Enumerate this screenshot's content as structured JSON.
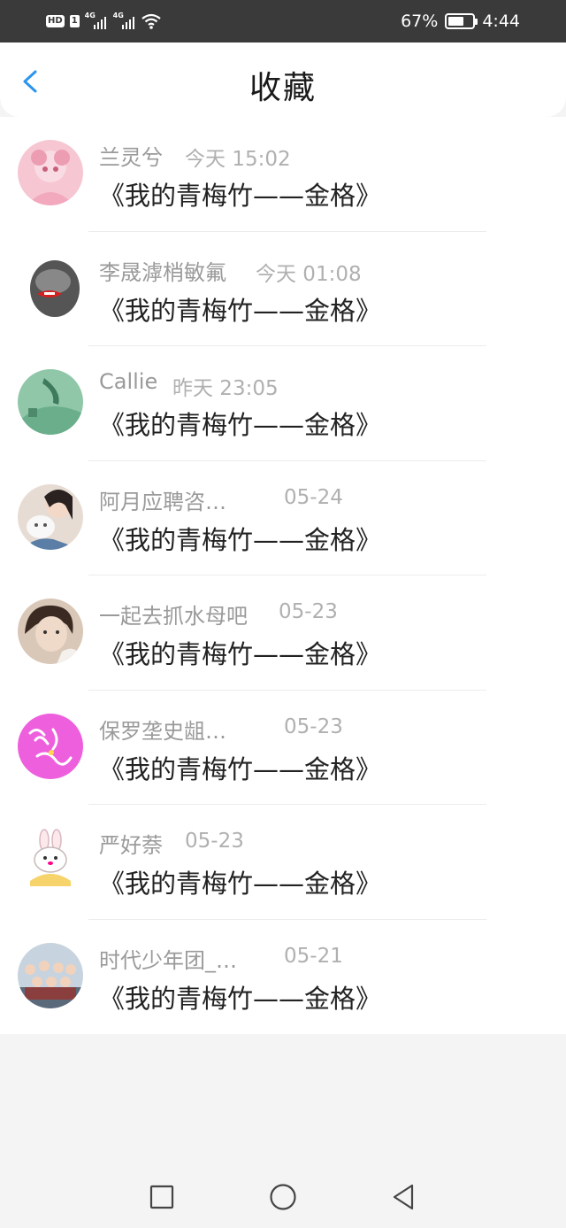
{
  "status_bar": {
    "hd": "HD",
    "sim": "1",
    "network1": "4G",
    "network2": "4G",
    "battery_percent": "67%",
    "battery_level": 0.67,
    "time": "4:44"
  },
  "header": {
    "title": "收藏",
    "back_icon": "chevron-left-icon"
  },
  "colors": {
    "accent": "#2b95ee",
    "status_bar_bg": "#3a3a3a",
    "name_text": "#9a9a9a",
    "time_text": "#b0b0b0",
    "content_text": "#222222"
  },
  "favorites": [
    {
      "name": "兰灵兮",
      "time": "今天 15:02",
      "content": "《我的青梅竹——金格》",
      "avatar": "pink-anime-avatar"
    },
    {
      "name": "李晟滹梢敏氟",
      "time": "今天 01:08",
      "content": "《我的青梅竹——金格》",
      "avatar": "monochrome-face-avatar"
    },
    {
      "name": "Callie",
      "time": "昨天 23:05",
      "content": "《我的青梅竹——金格》",
      "avatar": "green-abstract-avatar"
    },
    {
      "name": "阿月应聘咨…",
      "time": "05-24",
      "content": "《我的青梅竹——金格》",
      "avatar": "girl-with-cat-avatar"
    },
    {
      "name": "一起去抓水母吧",
      "time": "05-23",
      "content": "《我的青梅竹——金格》",
      "avatar": "portrait-avatar"
    },
    {
      "name": "保罗垄史龃…",
      "time": "05-23",
      "content": "《我的青梅竹——金格》",
      "avatar": "magenta-calligraphy-avatar"
    },
    {
      "name": "严好萘",
      "time": "05-23",
      "content": "《我的青梅竹——金格》",
      "avatar": "cartoon-bunny-avatar"
    },
    {
      "name": "时代少年团_…",
      "time": "05-21",
      "content": "《我的青梅竹——金格》",
      "avatar": "group-photo-avatar"
    }
  ],
  "nav_bar": {
    "recents_icon": "square-icon",
    "home_icon": "circle-icon",
    "back_icon": "triangle-back-icon"
  }
}
